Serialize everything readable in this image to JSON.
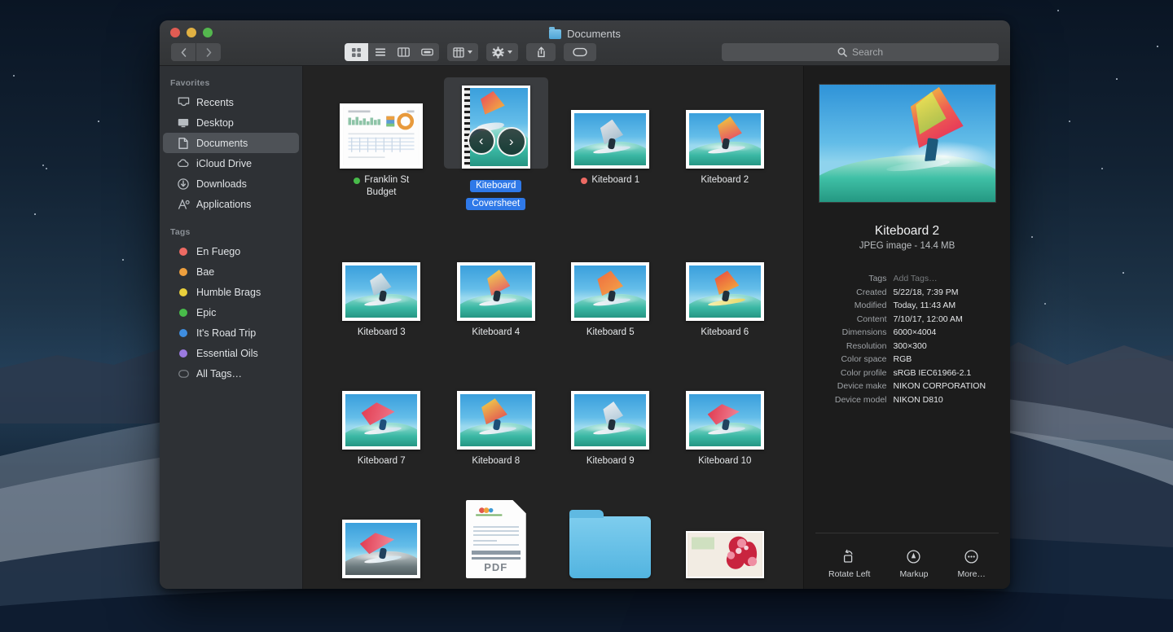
{
  "window": {
    "title": "Documents",
    "title_icon": "folder-icon"
  },
  "traffic_lights": [
    {
      "name": "close",
      "color": "#e05c53"
    },
    {
      "name": "minimize",
      "color": "#e0b042"
    },
    {
      "name": "zoom",
      "color": "#54b74e"
    }
  ],
  "toolbar": {
    "back_icon": "chevron-left-icon",
    "forward_icon": "chevron-right-icon",
    "view_modes": [
      {
        "name": "icon-view",
        "icon": "grid-icon",
        "active": true
      },
      {
        "name": "list-view",
        "icon": "list-icon",
        "active": false
      },
      {
        "name": "column-view",
        "icon": "columns-icon",
        "active": false
      },
      {
        "name": "gallery-view",
        "icon": "gallery-icon",
        "active": false
      }
    ],
    "group_by_icon": "group-icon",
    "action_icon": "gear-icon",
    "share_icon": "share-icon",
    "tags_icon": "tag-icon",
    "search": {
      "placeholder": "Search",
      "icon": "search-icon",
      "value": ""
    }
  },
  "sidebar": {
    "favorites_header": "Favorites",
    "favorites": [
      {
        "label": "Recents",
        "icon": "clock-tray-icon",
        "selected": false
      },
      {
        "label": "Desktop",
        "icon": "desktop-icon",
        "selected": false
      },
      {
        "label": "Documents",
        "icon": "document-icon",
        "selected": true
      },
      {
        "label": "iCloud Drive",
        "icon": "cloud-icon",
        "selected": false
      },
      {
        "label": "Downloads",
        "icon": "download-icon",
        "selected": false
      },
      {
        "label": "Applications",
        "icon": "applications-icon",
        "selected": false
      }
    ],
    "tags_header": "Tags",
    "tags": [
      {
        "label": "En Fuego",
        "color": "#ed6a63"
      },
      {
        "label": "Bae",
        "color": "#ed9f3e"
      },
      {
        "label": "Humble Brags",
        "color": "#e9cf3c"
      },
      {
        "label": "Epic",
        "color": "#48bb4a"
      },
      {
        "label": "It's Road Trip",
        "color": "#3f8ee0"
      },
      {
        "label": "Essential Oils",
        "color": "#9b7ae0"
      },
      {
        "label": "All Tags…",
        "color": "#55585b"
      }
    ]
  },
  "files": [
    {
      "name": "Franklin St Budget",
      "type": "spreadsheet",
      "tag_color": "#48bb4a",
      "selected": false
    },
    {
      "name": "Kiteboard Coversheet",
      "type": "coversheet",
      "tag_color": null,
      "selected": true
    },
    {
      "name": "Kiteboard 1",
      "type": "photo",
      "tag_color": "#ed6a63",
      "selected": false
    },
    {
      "name": "Kiteboard 2",
      "type": "photo",
      "tag_color": null,
      "selected": false
    },
    {
      "name": "Kiteboard 3",
      "type": "photo",
      "tag_color": null,
      "selected": false
    },
    {
      "name": "Kiteboard 4",
      "type": "photo",
      "tag_color": null,
      "selected": false
    },
    {
      "name": "Kiteboard 5",
      "type": "photo",
      "tag_color": null,
      "selected": false
    },
    {
      "name": "Kiteboard 6",
      "type": "photo",
      "tag_color": null,
      "selected": false
    },
    {
      "name": "Kiteboard 7",
      "type": "photo",
      "tag_color": null,
      "selected": false
    },
    {
      "name": "Kiteboard 8",
      "type": "photo",
      "tag_color": null,
      "selected": false
    },
    {
      "name": "Kiteboard 9",
      "type": "photo",
      "tag_color": null,
      "selected": false
    },
    {
      "name": "Kiteboard 10",
      "type": "photo",
      "tag_color": null,
      "selected": false
    },
    {
      "name": "",
      "type": "photo",
      "tag_color": null,
      "selected": false
    },
    {
      "name": "PDF",
      "type": "pdf",
      "tag_color": null,
      "selected": false
    },
    {
      "name": "",
      "type": "folder",
      "tag_color": null,
      "selected": false
    },
    {
      "name": "",
      "type": "photo-red",
      "tag_color": null,
      "selected": false
    }
  ],
  "quicklook": {
    "prev_icon": "arrow-left-icon",
    "next_icon": "arrow-right-icon"
  },
  "preview": {
    "title": "Kiteboard 2",
    "subtitle": "JPEG image - 14.4 MB",
    "metadata": [
      {
        "key": "Tags",
        "value": "Add Tags…",
        "placeholder": true
      },
      {
        "key": "Created",
        "value": "5/22/18, 7:39 PM",
        "placeholder": false
      },
      {
        "key": "Modified",
        "value": "Today, 11:43 AM",
        "placeholder": false
      },
      {
        "key": "Content",
        "value": "7/10/17, 12:00 AM",
        "placeholder": false
      },
      {
        "key": "Dimensions",
        "value": "6000×4004",
        "placeholder": false
      },
      {
        "key": "Resolution",
        "value": "300×300",
        "placeholder": false
      },
      {
        "key": "Color space",
        "value": "RGB",
        "placeholder": false
      },
      {
        "key": "Color profile",
        "value": "sRGB IEC61966-2.1",
        "placeholder": false
      },
      {
        "key": "Device make",
        "value": "NIKON CORPORATION",
        "placeholder": false
      },
      {
        "key": "Device model",
        "value": "NIKON D810",
        "placeholder": false
      }
    ],
    "quick_actions": [
      {
        "label": "Rotate Left",
        "icon": "rotate-left-icon"
      },
      {
        "label": "Markup",
        "icon": "markup-icon"
      },
      {
        "label": "More…",
        "icon": "more-icon"
      }
    ]
  }
}
